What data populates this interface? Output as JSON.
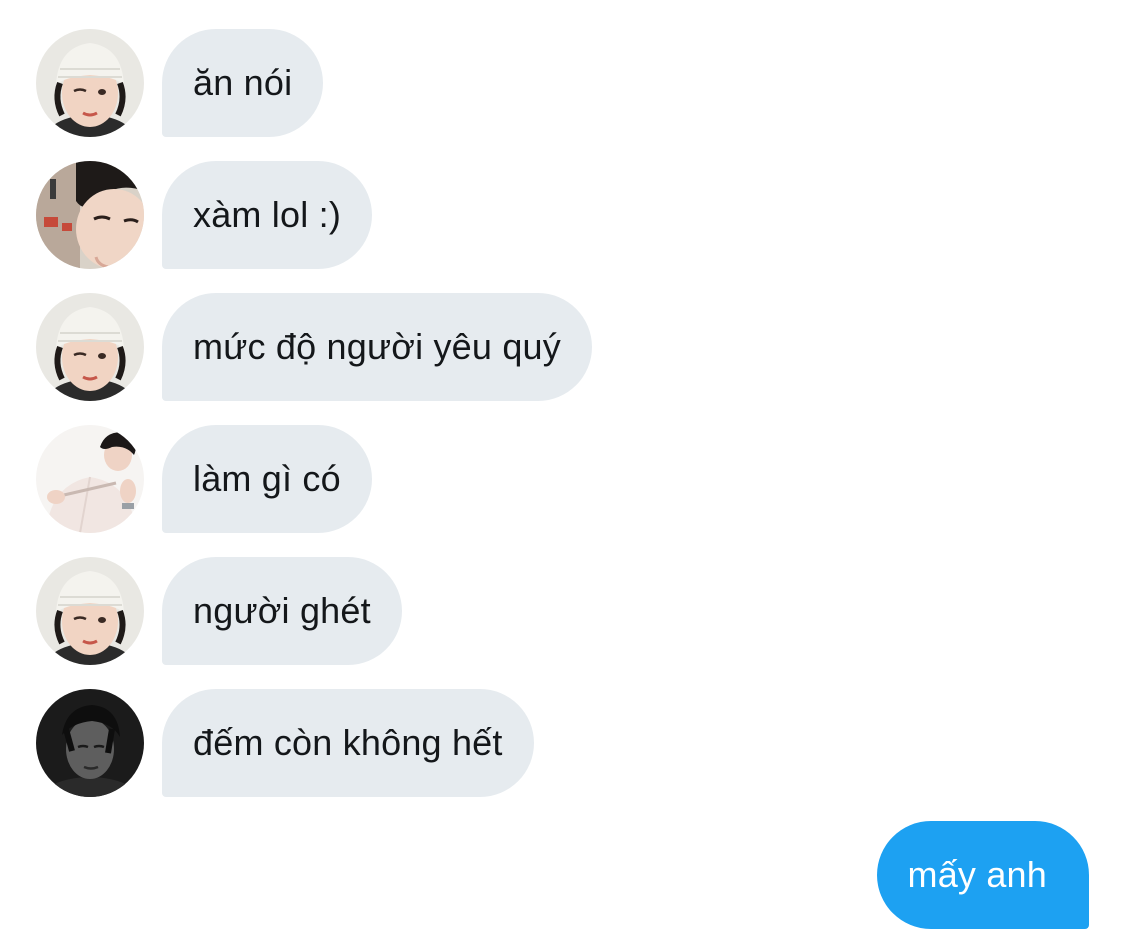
{
  "conversation": {
    "messages": [
      {
        "text": "ăn nói",
        "avatar": "beanie-wink-avatar"
      },
      {
        "text": "xàm lol :)",
        "avatar": "selfie-face-avatar"
      },
      {
        "text": "mức độ người yêu quý",
        "avatar": "beanie-wink-avatar"
      },
      {
        "text": "làm gì có",
        "avatar": "white-shirt-avatar"
      },
      {
        "text": "người ghét",
        "avatar": "beanie-wink-avatar"
      },
      {
        "text": "đếm còn không hết",
        "avatar": "dark-portrait-avatar"
      }
    ],
    "my_message": {
      "text": "mấy anh"
    }
  },
  "colors": {
    "incoming_bubble": "#e6ebef",
    "incoming_text": "#14171a",
    "outgoing_bubble": "#1da1f2",
    "outgoing_text": "#ffffff",
    "background": "#ffffff"
  }
}
